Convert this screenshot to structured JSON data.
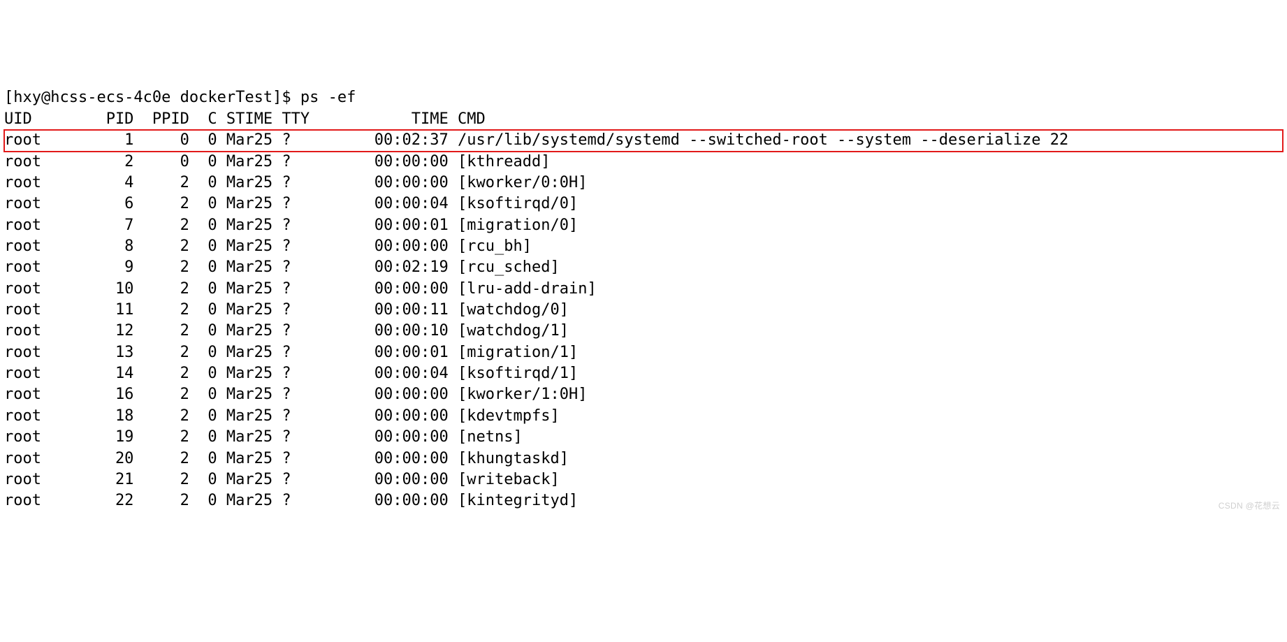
{
  "prompt": "[hxy@hcss-ecs-4c0e dockerTest]$ ps -ef",
  "headers": {
    "uid": "UID",
    "pid": "PID",
    "ppid": "PPID",
    "c": "C",
    "stime": "STIME",
    "tty": "TTY",
    "time": "TIME",
    "cmd": "CMD"
  },
  "rows": [
    {
      "uid": "root",
      "pid": "1",
      "ppid": "0",
      "c": "0",
      "stime": "Mar25",
      "tty": "?",
      "time": "00:02:37",
      "cmd": "/usr/lib/systemd/systemd --switched-root --system --deserialize 22",
      "highlight": true
    },
    {
      "uid": "root",
      "pid": "2",
      "ppid": "0",
      "c": "0",
      "stime": "Mar25",
      "tty": "?",
      "time": "00:00:00",
      "cmd": "[kthreadd]"
    },
    {
      "uid": "root",
      "pid": "4",
      "ppid": "2",
      "c": "0",
      "stime": "Mar25",
      "tty": "?",
      "time": "00:00:00",
      "cmd": "[kworker/0:0H]"
    },
    {
      "uid": "root",
      "pid": "6",
      "ppid": "2",
      "c": "0",
      "stime": "Mar25",
      "tty": "?",
      "time": "00:00:04",
      "cmd": "[ksoftirqd/0]"
    },
    {
      "uid": "root",
      "pid": "7",
      "ppid": "2",
      "c": "0",
      "stime": "Mar25",
      "tty": "?",
      "time": "00:00:01",
      "cmd": "[migration/0]"
    },
    {
      "uid": "root",
      "pid": "8",
      "ppid": "2",
      "c": "0",
      "stime": "Mar25",
      "tty": "?",
      "time": "00:00:00",
      "cmd": "[rcu_bh]"
    },
    {
      "uid": "root",
      "pid": "9",
      "ppid": "2",
      "c": "0",
      "stime": "Mar25",
      "tty": "?",
      "time": "00:02:19",
      "cmd": "[rcu_sched]"
    },
    {
      "uid": "root",
      "pid": "10",
      "ppid": "2",
      "c": "0",
      "stime": "Mar25",
      "tty": "?",
      "time": "00:00:00",
      "cmd": "[lru-add-drain]"
    },
    {
      "uid": "root",
      "pid": "11",
      "ppid": "2",
      "c": "0",
      "stime": "Mar25",
      "tty": "?",
      "time": "00:00:11",
      "cmd": "[watchdog/0]"
    },
    {
      "uid": "root",
      "pid": "12",
      "ppid": "2",
      "c": "0",
      "stime": "Mar25",
      "tty": "?",
      "time": "00:00:10",
      "cmd": "[watchdog/1]"
    },
    {
      "uid": "root",
      "pid": "13",
      "ppid": "2",
      "c": "0",
      "stime": "Mar25",
      "tty": "?",
      "time": "00:00:01",
      "cmd": "[migration/1]"
    },
    {
      "uid": "root",
      "pid": "14",
      "ppid": "2",
      "c": "0",
      "stime": "Mar25",
      "tty": "?",
      "time": "00:00:04",
      "cmd": "[ksoftirqd/1]"
    },
    {
      "uid": "root",
      "pid": "16",
      "ppid": "2",
      "c": "0",
      "stime": "Mar25",
      "tty": "?",
      "time": "00:00:00",
      "cmd": "[kworker/1:0H]"
    },
    {
      "uid": "root",
      "pid": "18",
      "ppid": "2",
      "c": "0",
      "stime": "Mar25",
      "tty": "?",
      "time": "00:00:00",
      "cmd": "[kdevtmpfs]"
    },
    {
      "uid": "root",
      "pid": "19",
      "ppid": "2",
      "c": "0",
      "stime": "Mar25",
      "tty": "?",
      "time": "00:00:00",
      "cmd": "[netns]"
    },
    {
      "uid": "root",
      "pid": "20",
      "ppid": "2",
      "c": "0",
      "stime": "Mar25",
      "tty": "?",
      "time": "00:00:00",
      "cmd": "[khungtaskd]"
    },
    {
      "uid": "root",
      "pid": "21",
      "ppid": "2",
      "c": "0",
      "stime": "Mar25",
      "tty": "?",
      "time": "00:00:00",
      "cmd": "[writeback]"
    },
    {
      "uid": "root",
      "pid": "22",
      "ppid": "2",
      "c": "0",
      "stime": "Mar25",
      "tty": "?",
      "time": "00:00:00",
      "cmd": "[kintegrityd]"
    }
  ],
  "watermark": "CSDN @花想云",
  "cols": {
    "uid": 8,
    "pid": 6,
    "ppid": 6,
    "c": 3,
    "stime": 6,
    "tty": 9,
    "time": 9,
    "cmd": 0
  }
}
